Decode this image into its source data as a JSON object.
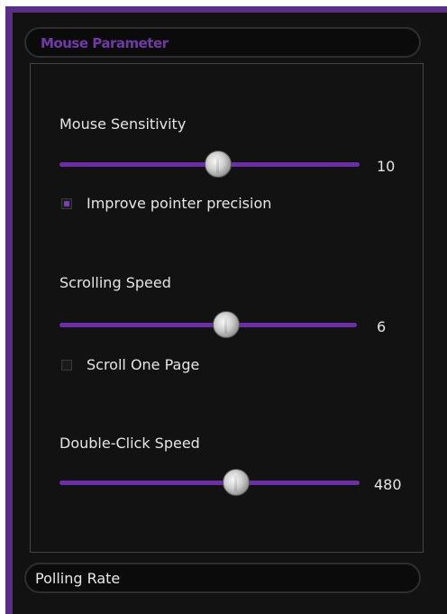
{
  "mouse_parameter": {
    "header_label": "Mouse Parameter",
    "sensitivity": {
      "label": "Mouse Sensitivity",
      "value": "10",
      "slider_fraction": 0.53,
      "checkbox_label": "Improve pointer precision",
      "checkbox_checked": true
    },
    "scrolling": {
      "label": "Scrolling Speed",
      "value": "6",
      "slider_fraction": 0.56,
      "checkbox_label": "Scroll One Page",
      "checkbox_checked": false
    },
    "double_click": {
      "label": "Double-Click Speed",
      "value": "480",
      "slider_fraction": 0.59
    }
  },
  "polling_rate": {
    "header_label": "Polling Rate"
  },
  "colors": {
    "accent": "#6c2fa8",
    "background": "#121212",
    "frame": "#5a2e86",
    "text": "#e6e6e6"
  }
}
